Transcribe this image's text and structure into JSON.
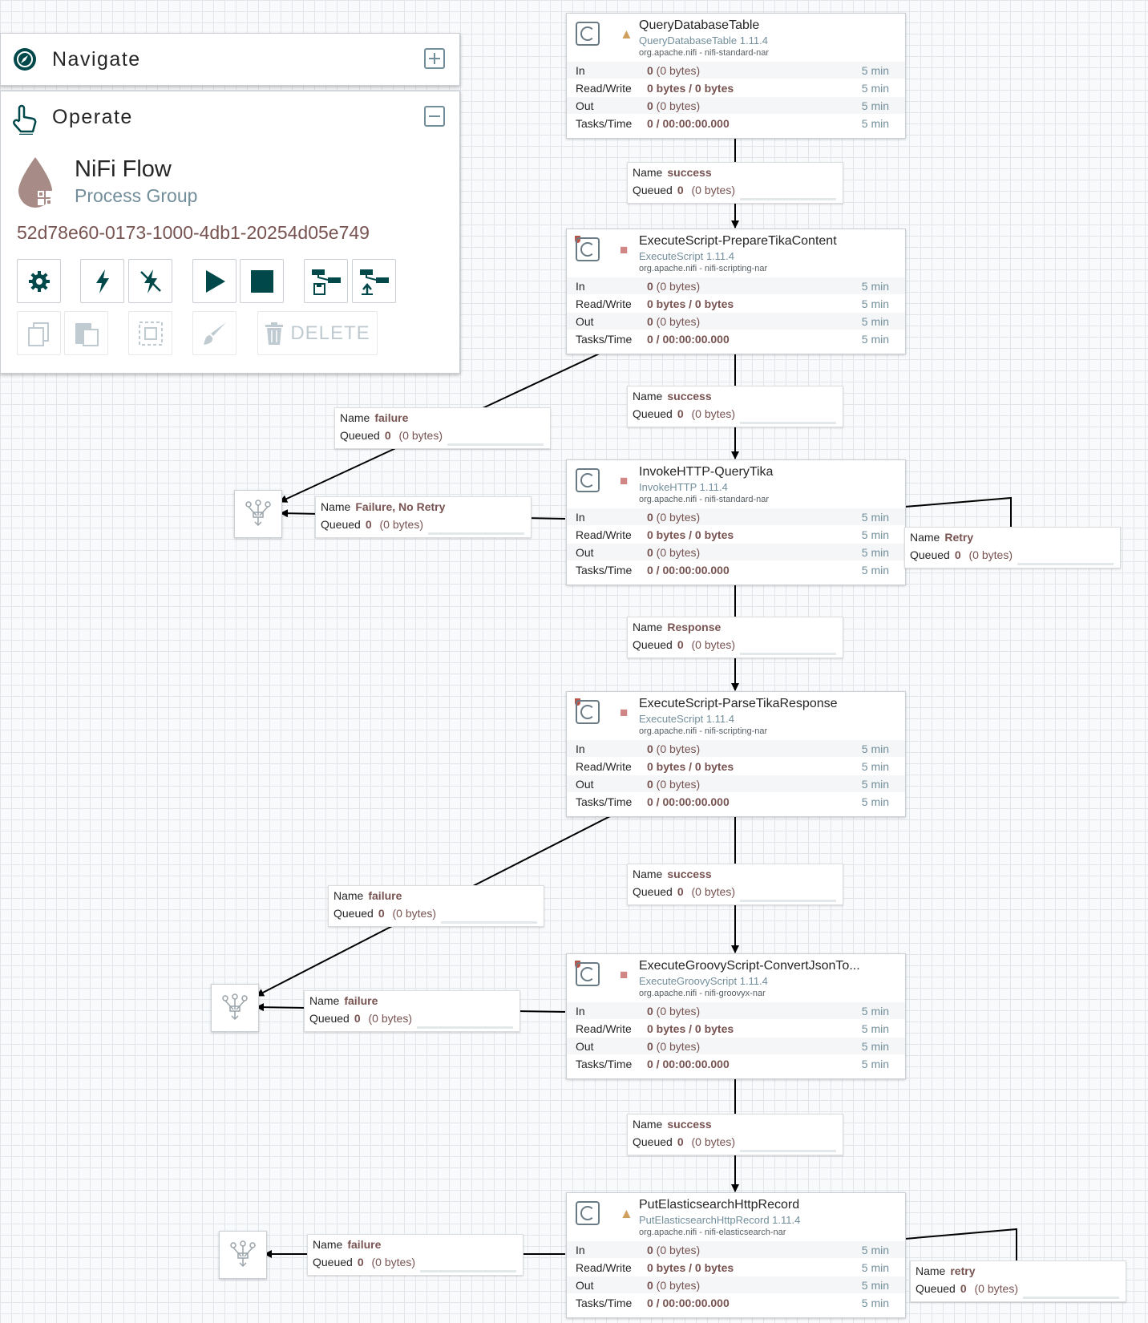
{
  "navigate": {
    "title": "Navigate"
  },
  "operate": {
    "title": "Operate",
    "group_name": "NiFi Flow",
    "group_type": "Process Group",
    "group_id": "52d78e60-0173-1000-4db1-20254d05e749",
    "delete_label": "DELETE"
  },
  "processors": [
    {
      "name": "QueryDatabaseTable",
      "type": "QueryDatabaseTable 1.11.4",
      "bundle": "org.apache.nifi - nifi-standard-nar",
      "status": "warning",
      "stats": [
        {
          "label": "In",
          "bold": "0",
          "rest": " (0 bytes)",
          "time": "5 min"
        },
        {
          "label": "Read/Write",
          "bold": "0 bytes / 0 bytes",
          "rest": "",
          "time": "5 min"
        },
        {
          "label": "Out",
          "bold": "0",
          "rest": " (0 bytes)",
          "time": "5 min"
        },
        {
          "label": "Tasks/Time",
          "bold": "0 / 00:00:00.000",
          "rest": "",
          "time": "5 min"
        }
      ]
    },
    {
      "name": "ExecuteScript-PrepareTikaContent",
      "type": "ExecuteScript 1.11.4",
      "bundle": "org.apache.nifi - nifi-scripting-nar",
      "status": "stopped",
      "stats": [
        {
          "label": "In",
          "bold": "0",
          "rest": " (0 bytes)",
          "time": "5 min"
        },
        {
          "label": "Read/Write",
          "bold": "0 bytes / 0 bytes",
          "rest": "",
          "time": "5 min"
        },
        {
          "label": "Out",
          "bold": "0",
          "rest": " (0 bytes)",
          "time": "5 min"
        },
        {
          "label": "Tasks/Time",
          "bold": "0 / 00:00:00.000",
          "rest": "",
          "time": "5 min"
        }
      ]
    },
    {
      "name": "InvokeHTTP-QueryTika",
      "type": "InvokeHTTP 1.11.4",
      "bundle": "org.apache.nifi - nifi-standard-nar",
      "status": "stopped",
      "stats": [
        {
          "label": "In",
          "bold": "0",
          "rest": " (0 bytes)",
          "time": "5 min"
        },
        {
          "label": "Read/Write",
          "bold": "0 bytes / 0 bytes",
          "rest": "",
          "time": "5 min"
        },
        {
          "label": "Out",
          "bold": "0",
          "rest": " (0 bytes)",
          "time": "5 min"
        },
        {
          "label": "Tasks/Time",
          "bold": "0 / 00:00:00.000",
          "rest": "",
          "time": "5 min"
        }
      ]
    },
    {
      "name": "ExecuteScript-ParseTikaResponse",
      "type": "ExecuteScript 1.11.4",
      "bundle": "org.apache.nifi - nifi-scripting-nar",
      "status": "stopped",
      "stats": [
        {
          "label": "In",
          "bold": "0",
          "rest": " (0 bytes)",
          "time": "5 min"
        },
        {
          "label": "Read/Write",
          "bold": "0 bytes / 0 bytes",
          "rest": "",
          "time": "5 min"
        },
        {
          "label": "Out",
          "bold": "0",
          "rest": " (0 bytes)",
          "time": "5 min"
        },
        {
          "label": "Tasks/Time",
          "bold": "0 / 00:00:00.000",
          "rest": "",
          "time": "5 min"
        }
      ]
    },
    {
      "name": "ExecuteGroovyScript-ConvertJsonTo...",
      "type": "ExecuteGroovyScript 1.11.4",
      "bundle": "org.apache.nifi - nifi-groovyx-nar",
      "status": "stopped",
      "stats": [
        {
          "label": "In",
          "bold": "0",
          "rest": " (0 bytes)",
          "time": "5 min"
        },
        {
          "label": "Read/Write",
          "bold": "0 bytes / 0 bytes",
          "rest": "",
          "time": "5 min"
        },
        {
          "label": "Out",
          "bold": "0",
          "rest": " (0 bytes)",
          "time": "5 min"
        },
        {
          "label": "Tasks/Time",
          "bold": "0 / 00:00:00.000",
          "rest": "",
          "time": "5 min"
        }
      ]
    },
    {
      "name": "PutElasticsearchHttpRecord",
      "type": "PutElasticsearchHttpRecord 1.11.4",
      "bundle": "org.apache.nifi - nifi-elasticsearch-nar",
      "status": "warning",
      "stats": [
        {
          "label": "In",
          "bold": "0",
          "rest": " (0 bytes)",
          "time": "5 min"
        },
        {
          "label": "Read/Write",
          "bold": "0 bytes / 0 bytes",
          "rest": "",
          "time": "5 min"
        },
        {
          "label": "Out",
          "bold": "0",
          "rest": " (0 bytes)",
          "time": "5 min"
        },
        {
          "label": "Tasks/Time",
          "bold": "0 / 00:00:00.000",
          "rest": "",
          "time": "5 min"
        }
      ]
    }
  ],
  "connections": [
    {
      "name": "success",
      "count": "0",
      "bytes": "(0 bytes)"
    },
    {
      "name": "success",
      "count": "0",
      "bytes": "(0 bytes)"
    },
    {
      "name": "failure",
      "count": "0",
      "bytes": "(0 bytes)"
    },
    {
      "name": "Failure, No Retry",
      "count": "0",
      "bytes": "(0 bytes)"
    },
    {
      "name": "Retry",
      "count": "0",
      "bytes": "(0 bytes)"
    },
    {
      "name": "Response",
      "count": "0",
      "bytes": "(0 bytes)"
    },
    {
      "name": "success",
      "count": "0",
      "bytes": "(0 bytes)"
    },
    {
      "name": "failure",
      "count": "0",
      "bytes": "(0 bytes)"
    },
    {
      "name": "failure",
      "count": "0",
      "bytes": "(0 bytes)"
    },
    {
      "name": "success",
      "count": "0",
      "bytes": "(0 bytes)"
    },
    {
      "name": "failure",
      "count": "0",
      "bytes": "(0 bytes)"
    },
    {
      "name": "retry",
      "count": "0",
      "bytes": "(0 bytes)"
    }
  ],
  "conn_labels": {
    "name": "Name",
    "queued": "Queued"
  },
  "icons": {
    "navigate": "compass-icon",
    "operate": "hand-pointer-icon",
    "group": "nifi-drop-icon",
    "processor": "processor-icon",
    "warning": "warning-icon",
    "stopped": "stopped-icon",
    "funnel": "funnel-icon"
  },
  "colors": {
    "accent": "#728e9b",
    "dark": "#004849",
    "value": "#775351",
    "warning": "#cf9f5d",
    "stopped": "#d18686"
  }
}
